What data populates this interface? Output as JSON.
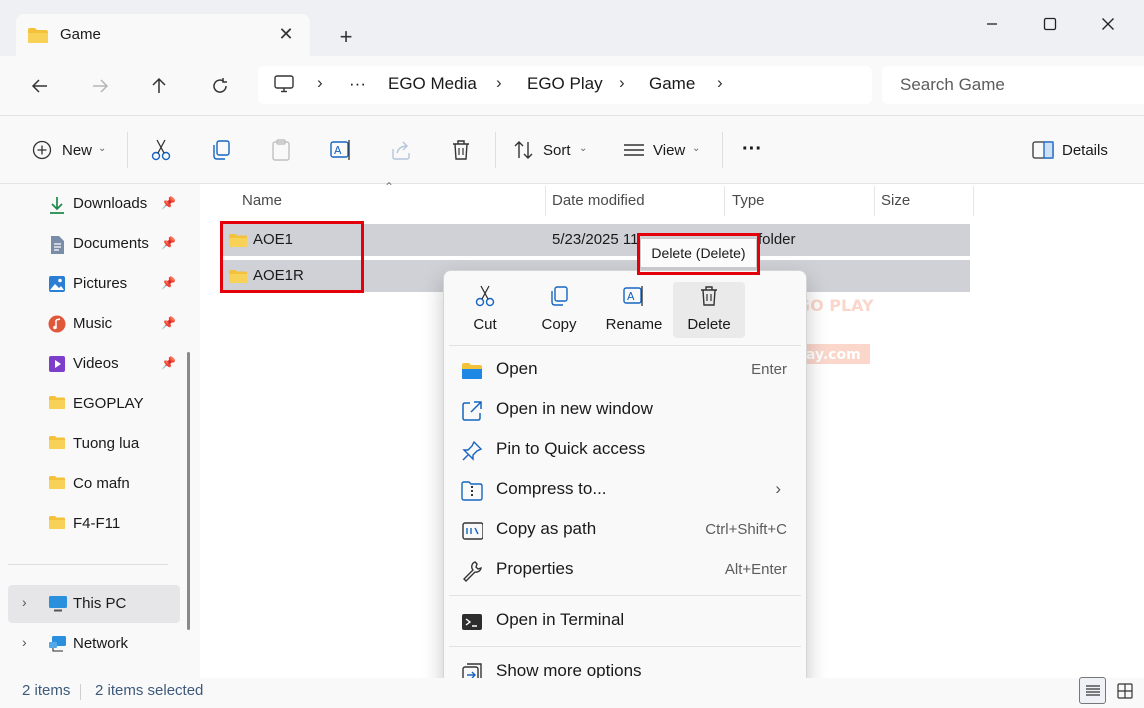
{
  "window": {
    "tab_title": "Game",
    "new_tab_label": "+"
  },
  "address": {
    "overflow": "···",
    "crumbs": [
      "EGO Media",
      "EGO Play",
      "Game"
    ],
    "search_placeholder": "Search Game"
  },
  "toolbar": {
    "new_label": "New",
    "sort_label": "Sort",
    "view_label": "View",
    "more_label": "···",
    "details_label": "Details"
  },
  "sidebar": {
    "items": [
      {
        "label": "Downloads",
        "icon": "download-icon",
        "pinned": true
      },
      {
        "label": "Documents",
        "icon": "documents-icon",
        "pinned": true
      },
      {
        "label": "Pictures",
        "icon": "pictures-icon",
        "pinned": true
      },
      {
        "label": "Music",
        "icon": "music-icon",
        "pinned": true
      },
      {
        "label": "Videos",
        "icon": "videos-icon",
        "pinned": true
      },
      {
        "label": "EGOPLAY",
        "icon": "folder-icon"
      },
      {
        "label": "Tuong lua",
        "icon": "folder-icon"
      },
      {
        "label": "Co mafn",
        "icon": "folder-icon"
      },
      {
        "label": "F4-F11",
        "icon": "folder-icon"
      },
      {
        "label": "This PC",
        "icon": "pc-icon",
        "selected": true
      },
      {
        "label": "Network",
        "icon": "network-icon"
      }
    ]
  },
  "columns": {
    "name": "Name",
    "date": "Date modified",
    "type": "Type",
    "size": "Size"
  },
  "files": [
    {
      "name": "AOE1",
      "date": "5/23/2025 11",
      "type": "folder"
    },
    {
      "name": "AOE1R",
      "date": "",
      "type": ""
    }
  ],
  "tooltip": "Delete (Delete)",
  "context_menu": {
    "top": [
      {
        "label": "Cut",
        "icon": "cut-icon"
      },
      {
        "label": "Copy",
        "icon": "copy-icon"
      },
      {
        "label": "Rename",
        "icon": "rename-icon"
      },
      {
        "label": "Delete",
        "icon": "delete-icon"
      }
    ],
    "items": [
      {
        "label": "Open",
        "shortcut": "Enter",
        "icon": "folder-open-icon"
      },
      {
        "label": "Open in new window",
        "shortcut": "",
        "icon": "new-window-icon"
      },
      {
        "label": "Pin to Quick access",
        "shortcut": "",
        "icon": "pin-icon"
      },
      {
        "label": "Compress to...",
        "shortcut": "",
        "icon": "zip-icon"
      },
      {
        "label": "Copy as path",
        "shortcut": "Ctrl+Shift+C",
        "icon": "copy-path-icon"
      },
      {
        "label": "Properties",
        "shortcut": "Alt+Enter",
        "icon": "wrench-icon"
      },
      {
        "label": "Open in Terminal",
        "shortcut": "",
        "icon": "terminal-icon"
      },
      {
        "label": "Show more options",
        "shortcut": "",
        "icon": "more-options-icon"
      }
    ]
  },
  "watermark": {
    "brand": "EGO PLAY",
    "url": "www.ego-play.com"
  },
  "status": {
    "count": "2 items",
    "selected": "2 items selected"
  },
  "colors": {
    "accent": "#0067c0",
    "highlight_box": "#e3000b",
    "selected_row": "#cfd1d6",
    "folder": "#f3c13a"
  }
}
